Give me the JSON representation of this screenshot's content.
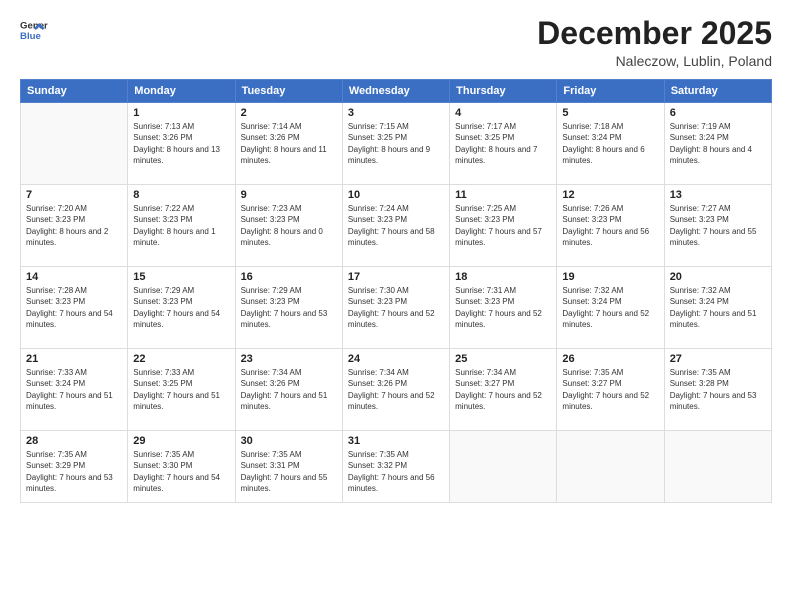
{
  "logo": {
    "line1": "General",
    "line2": "Blue"
  },
  "title": "December 2025",
  "location": "Naleczow, Lublin, Poland",
  "weekdays": [
    "Sunday",
    "Monday",
    "Tuesday",
    "Wednesday",
    "Thursday",
    "Friday",
    "Saturday"
  ],
  "weeks": [
    [
      {
        "day": "",
        "sunrise": "",
        "sunset": "",
        "daylight": ""
      },
      {
        "day": "1",
        "sunrise": "Sunrise: 7:13 AM",
        "sunset": "Sunset: 3:26 PM",
        "daylight": "Daylight: 8 hours and 13 minutes."
      },
      {
        "day": "2",
        "sunrise": "Sunrise: 7:14 AM",
        "sunset": "Sunset: 3:26 PM",
        "daylight": "Daylight: 8 hours and 11 minutes."
      },
      {
        "day": "3",
        "sunrise": "Sunrise: 7:15 AM",
        "sunset": "Sunset: 3:25 PM",
        "daylight": "Daylight: 8 hours and 9 minutes."
      },
      {
        "day": "4",
        "sunrise": "Sunrise: 7:17 AM",
        "sunset": "Sunset: 3:25 PM",
        "daylight": "Daylight: 8 hours and 7 minutes."
      },
      {
        "day": "5",
        "sunrise": "Sunrise: 7:18 AM",
        "sunset": "Sunset: 3:24 PM",
        "daylight": "Daylight: 8 hours and 6 minutes."
      },
      {
        "day": "6",
        "sunrise": "Sunrise: 7:19 AM",
        "sunset": "Sunset: 3:24 PM",
        "daylight": "Daylight: 8 hours and 4 minutes."
      }
    ],
    [
      {
        "day": "7",
        "sunrise": "Sunrise: 7:20 AM",
        "sunset": "Sunset: 3:23 PM",
        "daylight": "Daylight: 8 hours and 2 minutes."
      },
      {
        "day": "8",
        "sunrise": "Sunrise: 7:22 AM",
        "sunset": "Sunset: 3:23 PM",
        "daylight": "Daylight: 8 hours and 1 minute."
      },
      {
        "day": "9",
        "sunrise": "Sunrise: 7:23 AM",
        "sunset": "Sunset: 3:23 PM",
        "daylight": "Daylight: 8 hours and 0 minutes."
      },
      {
        "day": "10",
        "sunrise": "Sunrise: 7:24 AM",
        "sunset": "Sunset: 3:23 PM",
        "daylight": "Daylight: 7 hours and 58 minutes."
      },
      {
        "day": "11",
        "sunrise": "Sunrise: 7:25 AM",
        "sunset": "Sunset: 3:23 PM",
        "daylight": "Daylight: 7 hours and 57 minutes."
      },
      {
        "day": "12",
        "sunrise": "Sunrise: 7:26 AM",
        "sunset": "Sunset: 3:23 PM",
        "daylight": "Daylight: 7 hours and 56 minutes."
      },
      {
        "day": "13",
        "sunrise": "Sunrise: 7:27 AM",
        "sunset": "Sunset: 3:23 PM",
        "daylight": "Daylight: 7 hours and 55 minutes."
      }
    ],
    [
      {
        "day": "14",
        "sunrise": "Sunrise: 7:28 AM",
        "sunset": "Sunset: 3:23 PM",
        "daylight": "Daylight: 7 hours and 54 minutes."
      },
      {
        "day": "15",
        "sunrise": "Sunrise: 7:29 AM",
        "sunset": "Sunset: 3:23 PM",
        "daylight": "Daylight: 7 hours and 54 minutes."
      },
      {
        "day": "16",
        "sunrise": "Sunrise: 7:29 AM",
        "sunset": "Sunset: 3:23 PM",
        "daylight": "Daylight: 7 hours and 53 minutes."
      },
      {
        "day": "17",
        "sunrise": "Sunrise: 7:30 AM",
        "sunset": "Sunset: 3:23 PM",
        "daylight": "Daylight: 7 hours and 52 minutes."
      },
      {
        "day": "18",
        "sunrise": "Sunrise: 7:31 AM",
        "sunset": "Sunset: 3:23 PM",
        "daylight": "Daylight: 7 hours and 52 minutes."
      },
      {
        "day": "19",
        "sunrise": "Sunrise: 7:32 AM",
        "sunset": "Sunset: 3:24 PM",
        "daylight": "Daylight: 7 hours and 52 minutes."
      },
      {
        "day": "20",
        "sunrise": "Sunrise: 7:32 AM",
        "sunset": "Sunset: 3:24 PM",
        "daylight": "Daylight: 7 hours and 51 minutes."
      }
    ],
    [
      {
        "day": "21",
        "sunrise": "Sunrise: 7:33 AM",
        "sunset": "Sunset: 3:24 PM",
        "daylight": "Daylight: 7 hours and 51 minutes."
      },
      {
        "day": "22",
        "sunrise": "Sunrise: 7:33 AM",
        "sunset": "Sunset: 3:25 PM",
        "daylight": "Daylight: 7 hours and 51 minutes."
      },
      {
        "day": "23",
        "sunrise": "Sunrise: 7:34 AM",
        "sunset": "Sunset: 3:26 PM",
        "daylight": "Daylight: 7 hours and 51 minutes."
      },
      {
        "day": "24",
        "sunrise": "Sunrise: 7:34 AM",
        "sunset": "Sunset: 3:26 PM",
        "daylight": "Daylight: 7 hours and 52 minutes."
      },
      {
        "day": "25",
        "sunrise": "Sunrise: 7:34 AM",
        "sunset": "Sunset: 3:27 PM",
        "daylight": "Daylight: 7 hours and 52 minutes."
      },
      {
        "day": "26",
        "sunrise": "Sunrise: 7:35 AM",
        "sunset": "Sunset: 3:27 PM",
        "daylight": "Daylight: 7 hours and 52 minutes."
      },
      {
        "day": "27",
        "sunrise": "Sunrise: 7:35 AM",
        "sunset": "Sunset: 3:28 PM",
        "daylight": "Daylight: 7 hours and 53 minutes."
      }
    ],
    [
      {
        "day": "28",
        "sunrise": "Sunrise: 7:35 AM",
        "sunset": "Sunset: 3:29 PM",
        "daylight": "Daylight: 7 hours and 53 minutes."
      },
      {
        "day": "29",
        "sunrise": "Sunrise: 7:35 AM",
        "sunset": "Sunset: 3:30 PM",
        "daylight": "Daylight: 7 hours and 54 minutes."
      },
      {
        "day": "30",
        "sunrise": "Sunrise: 7:35 AM",
        "sunset": "Sunset: 3:31 PM",
        "daylight": "Daylight: 7 hours and 55 minutes."
      },
      {
        "day": "31",
        "sunrise": "Sunrise: 7:35 AM",
        "sunset": "Sunset: 3:32 PM",
        "daylight": "Daylight: 7 hours and 56 minutes."
      },
      {
        "day": "",
        "sunrise": "",
        "sunset": "",
        "daylight": ""
      },
      {
        "day": "",
        "sunrise": "",
        "sunset": "",
        "daylight": ""
      },
      {
        "day": "",
        "sunrise": "",
        "sunset": "",
        "daylight": ""
      }
    ]
  ]
}
